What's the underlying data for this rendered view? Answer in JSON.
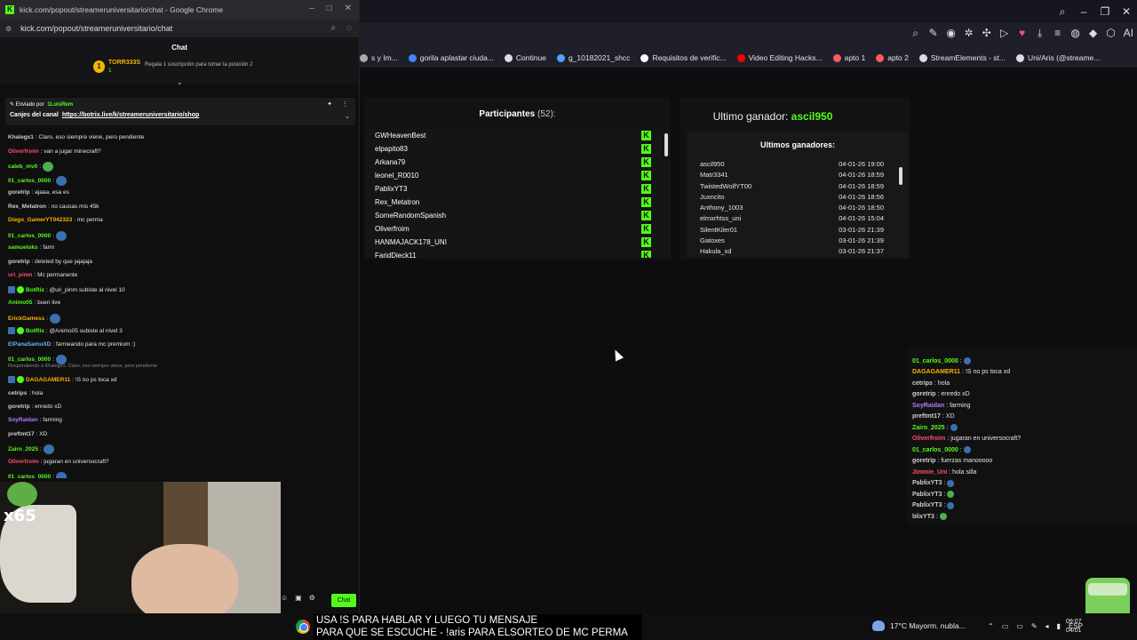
{
  "popup": {
    "window_title": "kick.com/popout/streameruniversitario/chat - Google Chrome",
    "url": "kick.com/popout/streameruniversitario/chat",
    "chat_header": "Chat",
    "sub_leader": {
      "rank": "1",
      "name": "TORR333S",
      "count": "1",
      "gift_text": "Regala 1 suscripción para tomar la posición 2"
    },
    "pinned": {
      "by_label": "Enviado por",
      "by_user": "1LuisRem",
      "text": "Canjes del canal",
      "link": "https://botrix.live/k/streameruniversitario/shop"
    },
    "messages": [
      {
        "user": "Khalegx1",
        "text": ": Claro, eso siempre viene, pero pendiente",
        "color": "#cfcfcf"
      },
      {
        "user": "Oliverfroim",
        "text": ": van a jugar minecraft?",
        "color": "#ff4d6d"
      },
      {
        "user": "caleb_mv0",
        "text": ":",
        "color": "#53fc18",
        "emote": "green"
      },
      {
        "user": "01_carlos_0000",
        "text": ":",
        "color": "#53fc18",
        "emote": "blue"
      },
      {
        "user": "goretrip",
        "text": ": ajaaa, esa es",
        "color": "#cfcfcf"
      },
      {
        "user": "Rex_Metatron",
        "text": ": no causas mis 45k",
        "color": "#cfcfcf"
      },
      {
        "user": "Diego_GamerYT042323",
        "text": ": mc perma",
        "color": "#f5b500"
      },
      {
        "user": "01_carlos_0000",
        "text": ":",
        "color": "#53fc18",
        "emote": "blue"
      },
      {
        "user": "samueloks",
        "text": ": farm",
        "color": "#53fc18"
      },
      {
        "user": "goretrip",
        "text": ": deleted by que jajajaja",
        "color": "#cfcfcf"
      },
      {
        "user": "uri_pinm",
        "text": ": Mc permanente",
        "color": "#ff4d6d"
      },
      {
        "user": "BotRix",
        "text": ": @uri_pinm subiste al nivel 10",
        "color": "#53fc18",
        "badges": true
      },
      {
        "user": "Animo05",
        "text": ": buen live",
        "color": "#53fc18"
      },
      {
        "user": "ErickGamess",
        "text": ":",
        "color": "#f5b500",
        "emote": "blue"
      },
      {
        "user": "BotRix",
        "text": ": @Animo05 subiste al nivel 3",
        "color": "#53fc18",
        "badges": true
      },
      {
        "user": "ElPanaSamuXD",
        "text": ": farmeando para mc premium :)",
        "color": "#6ab0ff"
      },
      {
        "user": "01_carlos_0000",
        "text": ":",
        "color": "#53fc18",
        "emote": "blue"
      },
      {
        "user": "DAGAGAMER11",
        "text": ": !S no ps toca xd",
        "color": "#f5b500",
        "badges": true
      },
      {
        "user": "cetrips",
        "text": ": hola",
        "color": "#cfcfcf"
      },
      {
        "user": "goretrip",
        "text": ": enredo xD",
        "color": "#cfcfcf"
      },
      {
        "user": "SoyRaidan",
        "text": ": farming",
        "color": "#b57cff"
      },
      {
        "user": "preftmt17",
        "text": ": XD",
        "color": "#cfcfcf"
      },
      {
        "user": "Zairo_2025",
        "text": ":",
        "color": "#53fc18",
        "emote": "blue"
      },
      {
        "user": "Oliverfroim",
        "text": ": jugaran en universocraft?",
        "color": "#ff4d6d"
      },
      {
        "user": "01_carlos_0000",
        "text": ":",
        "color": "#53fc18",
        "emote": "blue"
      }
    ],
    "reply_context": "Respondiendo a Khalegx1: Claro, eso siempre viene, pero pendiente",
    "webcam_overlay": "x65",
    "chat_button": "Chat"
  },
  "browser": {
    "bookmarks": [
      {
        "label": "s y Im...",
        "color": "#aaa"
      },
      {
        "label": "gorila aplastar ciuda...",
        "color": "#4285f4"
      },
      {
        "label": "Continue",
        "color": "#ddd"
      },
      {
        "label": "g_10182021_shcc",
        "color": "#4fa3ff"
      },
      {
        "label": "Requisitos de verific...",
        "color": "#fff"
      },
      {
        "label": "Video Editing Hacks...",
        "color": "#ff0000"
      },
      {
        "label": "apto 1",
        "color": "#ff5a5f"
      },
      {
        "label": "apto 2",
        "color": "#ff5a5f"
      },
      {
        "label": "StreamElements - st...",
        "color": "#ddd"
      },
      {
        "label": "Uni/Aris (@streame...",
        "color": "#ddd"
      }
    ],
    "ai_label": "AI"
  },
  "participants": {
    "title": "Participantes",
    "count": "(52):",
    "list": [
      "GWHeavenBest",
      "elpapito83",
      "Arkana79",
      "leonel_R0010",
      "PablixYT3",
      "Rex_Metatron",
      "SomeRandomSpanish",
      "Oliverfroim",
      "HANMAJACK178_UNI",
      "FaridDieck11"
    ]
  },
  "winners": {
    "title_prefix": "Ultimo ganador:",
    "last_winner": "ascil950",
    "subtitle": "Ultimos ganadores:",
    "list": [
      {
        "name": "ascil950",
        "date": "04-01-26 19:00"
      },
      {
        "name": "Matr3341",
        "date": "04-01-26 18:59"
      },
      {
        "name": "TwistedWolfYT00",
        "date": "04-01-26 18:59"
      },
      {
        "name": "Juxncito",
        "date": "04-01-26 18:56"
      },
      {
        "name": "Anthony_1003",
        "date": "04-01-26 18:50"
      },
      {
        "name": "elmxrhtss_uni",
        "date": "04-01-26 15:04"
      },
      {
        "name": "SilentKiler01",
        "date": "03-01-26 21:39"
      },
      {
        "name": "Gatoxes",
        "date": "03-01-26 21:39"
      },
      {
        "name": "Hakula_xd",
        "date": "03-01-26 21:37"
      }
    ]
  },
  "right_chat": [
    {
      "user": "01_carlos_0000",
      "text": ":",
      "color": "#53fc18",
      "emote": "blue"
    },
    {
      "user": "DAGAGAMER11",
      "text": ": !S no ps toca xd",
      "color": "#f5b500"
    },
    {
      "user": "cetrips",
      "text": ": hola",
      "color": "#cfcfcf"
    },
    {
      "user": "goretrip",
      "text": ": enredo xD",
      "color": "#cfcfcf"
    },
    {
      "user": "SoyRaidan",
      "text": ": farming",
      "color": "#b57cff"
    },
    {
      "user": "preftmt17",
      "text": ": XD",
      "color": "#cfcfcf"
    },
    {
      "user": "Zairo_2025",
      "text": ":",
      "color": "#53fc18",
      "emote": "blue"
    },
    {
      "user": "Oliverfroim",
      "text": ": jugaran en universocraft?",
      "color": "#ff4d6d"
    },
    {
      "user": "01_carlos_0000",
      "text": ":",
      "color": "#53fc18",
      "emote": "blue"
    },
    {
      "user": "goretrip",
      "text": ": fuerzas manooooo",
      "color": "#cfcfcf"
    },
    {
      "user": "Jimmie_Uni",
      "text": ": hola silla",
      "color": "#ff4d6d"
    },
    {
      "user": "PablixYT3",
      "text": ":",
      "color": "#cfcfcf",
      "emote": "blue"
    },
    {
      "user": "PablixYT3",
      "text": ":",
      "color": "#cfcfcf",
      "emote": "green"
    },
    {
      "user": "PablixYT3",
      "text": ":",
      "color": "#cfcfcf",
      "emote": "blue"
    },
    {
      "user": "blixYT3",
      "text": ":",
      "color": "#cfcfcf",
      "emote": "green"
    }
  ],
  "taskbar": {
    "subtitle_line1": "USA !S PARA HABLAR Y LUEGO TU MENSAJE",
    "subtitle_line2": "PARA QUE SE ESCUCHE - !aris PARA ELSORTEO DE MC PERMA",
    "weather": "17°C Mayorm. nubla...",
    "lang": "ESP",
    "time": "09:07",
    "date": "04/01"
  }
}
